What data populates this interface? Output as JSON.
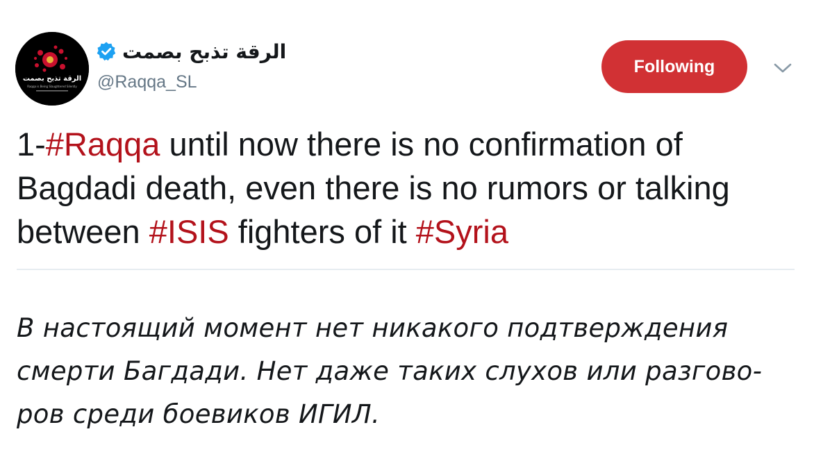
{
  "tweet": {
    "author": {
      "display_name": "الرقة تذبح بصمت",
      "handle": "@Raqqa_SL",
      "verified": true,
      "avatar_text": "الرقة تذبح بصمت",
      "avatar_subtext": "Raqqa is Being Slaughtered Silently"
    },
    "follow_button": {
      "label": "Following",
      "color": "#d13134"
    },
    "menu_icon": "chevron-down-icon",
    "text_segments": {
      "s1": "1-",
      "h1": "#Raqqa",
      "s2": " until now there is no confirmation of Bagdadi death, even there is no rumors or talking between ",
      "h2": "#ISIS",
      "s3": " fighters of it ",
      "h3": "#Syria"
    },
    "hashtag_color": "#b3121b"
  },
  "translation": {
    "lines": [
      "В настоящий момент нет никакого подтверждения",
      "смерти Багдади. Нет даже таких слухов или разгово-",
      "ров среди боевиков ИГИЛ."
    ]
  }
}
